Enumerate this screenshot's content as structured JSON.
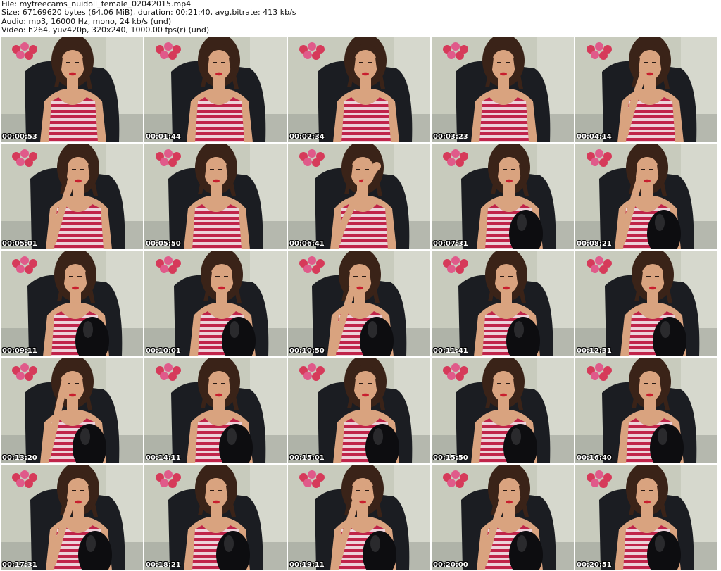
{
  "header": {
    "file": "File: myfreecams_nuidoll_female_02042015.mp4",
    "size": "Size: 67169620 bytes (64.06 MiB), duration: 00:21:40, avg.bitrate: 413 kb/s",
    "audio": "Audio: mp3, 16000 Hz, mono, 24 kb/s (und)",
    "video": "Video: h264, yuv420p, 320x240, 1000.00 fps(r) (und)"
  },
  "thumbnails": [
    {
      "time": "00:00:53",
      "pose": "default"
    },
    {
      "time": "00:01:44",
      "pose": "default"
    },
    {
      "time": "00:02:34",
      "pose": "default"
    },
    {
      "time": "00:03:23",
      "pose": "default"
    },
    {
      "time": "00:04:14",
      "pose": "arm-across"
    },
    {
      "time": "00:05:01",
      "pose": "hand-chin"
    },
    {
      "time": "00:05:50",
      "pose": "default"
    },
    {
      "time": "00:06:41",
      "pose": "hand-hair"
    },
    {
      "time": "00:07:31",
      "pose": "knee"
    },
    {
      "time": "00:08:21",
      "pose": "hand-face-knee"
    },
    {
      "time": "00:09:11",
      "pose": "knee"
    },
    {
      "time": "00:10:01",
      "pose": "knee"
    },
    {
      "time": "00:10:50",
      "pose": "arm-knee"
    },
    {
      "time": "00:11:41",
      "pose": "knee"
    },
    {
      "time": "00:12:31",
      "pose": "knee"
    },
    {
      "time": "00:13:20",
      "pose": "hand-forehead-knee"
    },
    {
      "time": "00:14:11",
      "pose": "knee"
    },
    {
      "time": "00:15:01",
      "pose": "knee"
    },
    {
      "time": "00:15:50",
      "pose": "knee"
    },
    {
      "time": "00:16:40",
      "pose": "knee"
    },
    {
      "time": "00:17:31",
      "pose": "arms-crossed-knee"
    },
    {
      "time": "00:18:21",
      "pose": "knee"
    },
    {
      "time": "00:19:11",
      "pose": "hand-chin-knee"
    },
    {
      "time": "00:20:00",
      "pose": "arm-knee"
    },
    {
      "time": "00:20:51",
      "pose": "knee"
    }
  ],
  "colors": {
    "wall": "#c8cbbd",
    "wall_shadow": "#9fa39a",
    "chair": "#1b1d22",
    "skin": "#d9a37f",
    "hair": "#3a2318",
    "stripe_red": "#c0244a",
    "stripe_white": "#f2e6ea",
    "lips": "#c81e2e",
    "flowers": "#d63a5a",
    "boot": "#0d0d10",
    "timestamp": "#ffffff"
  }
}
